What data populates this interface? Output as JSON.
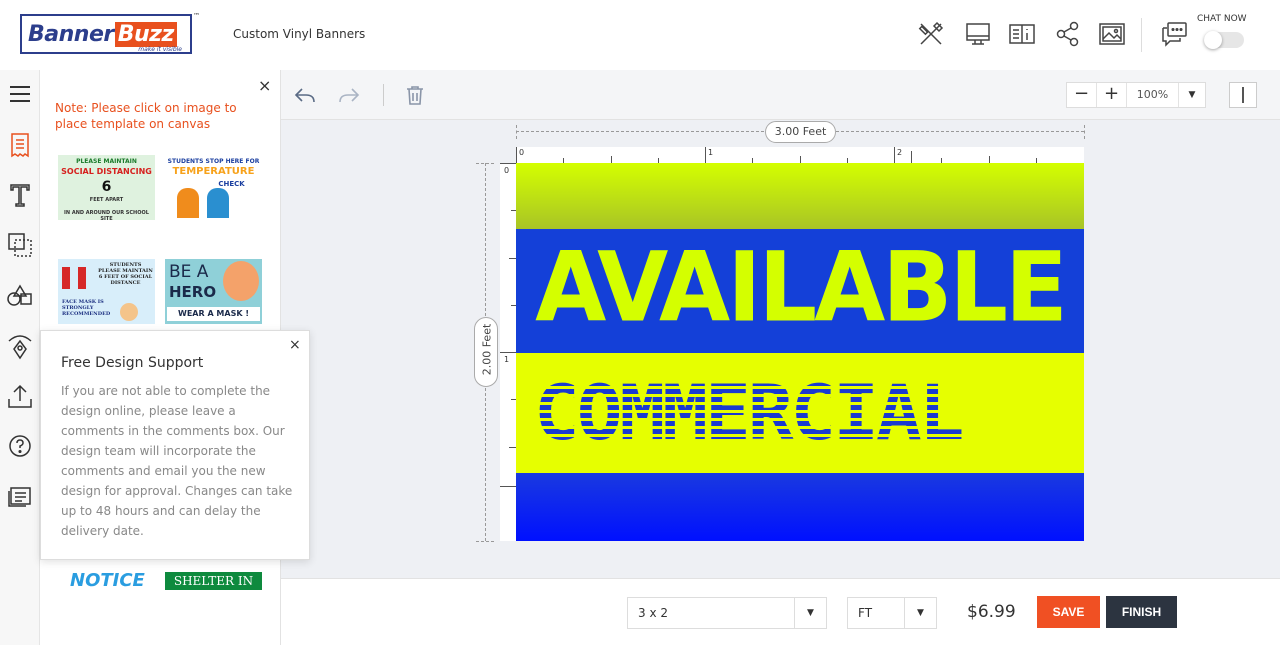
{
  "header": {
    "logo_left": "Banner",
    "logo_right": "Buzz",
    "logo_tagline": "make it visible",
    "logo_tm": "™",
    "product_title": "Custom Vinyl Banners",
    "chat_label": "CHAT NOW"
  },
  "panel": {
    "close_glyph": "×",
    "note": "Note: Please click on image to place template on canvas",
    "templates": {
      "t1_line1": "PLEASE MAINTAIN",
      "t1_line2": "SOCIAL DISTANCING",
      "t1_number": "6",
      "t1_line3": "FEET APART",
      "t1_line4": "IN AND AROUND OUR SCHOOL SITE",
      "t2_line1": "STUDENTS STOP HERE FOR",
      "t2_line2": "TEMPERATURE",
      "t2_line3": "CHECK",
      "t3_line1": "STUDENTS PLEASE MAINTAIN 6 FEET OF SOCIAL DISTANCE",
      "t3_line2": "FACE MASK IS STRONGLY RECOMMENDED",
      "t4_line1": "BE A",
      "t4_line2": "HERO",
      "t4_line3": "WEAR A MASK !",
      "t5": "NOTICE",
      "t6": "SHELTER IN"
    }
  },
  "support": {
    "close_glyph": "×",
    "title": "Free Design Support",
    "body": "If you are not able to complete the design online, please leave a comments in the comments box. Our design team will incorporate the comments and email you the new design for approval. Changes can take up to 48 hours and can delay the delivery date."
  },
  "toolbar": {
    "zoom_minus": "−",
    "zoom_plus": "+",
    "zoom_value": "100%",
    "zoom_dropdown": "▼"
  },
  "canvas": {
    "width_label": "3.00 Feet",
    "height_label": "2.00 Feet",
    "ruler_top": [
      "0",
      "1",
      "2"
    ],
    "ruler_left": [
      "0",
      "1"
    ],
    "banner_line1": "AVAILABLE",
    "banner_line2": "COMMERCIAL"
  },
  "footer": {
    "size_value": "3 x 2",
    "unit_value": "FT",
    "dropdown_glyph": "▼",
    "price": "$6.99",
    "save_label": "SAVE",
    "finish_label": "FINISH"
  },
  "icons": {
    "header": [
      "design-tools-icon",
      "preview-monitor-icon",
      "specs-icon",
      "share-icon",
      "image-icon",
      "chat-icon"
    ],
    "rail": [
      "menu-icon",
      "templates-icon",
      "text-icon",
      "background-icon",
      "shapes-icon",
      "clipart-icon",
      "upload-icon",
      "help-icon",
      "comments-icon"
    ],
    "toolbar": [
      "undo-icon",
      "redo-icon",
      "delete-icon"
    ]
  },
  "colors": {
    "brand_blue": "#2c3e8c",
    "brand_orange": "#e8501e",
    "save_button": "#f05023",
    "finish_button": "#2c3440"
  }
}
